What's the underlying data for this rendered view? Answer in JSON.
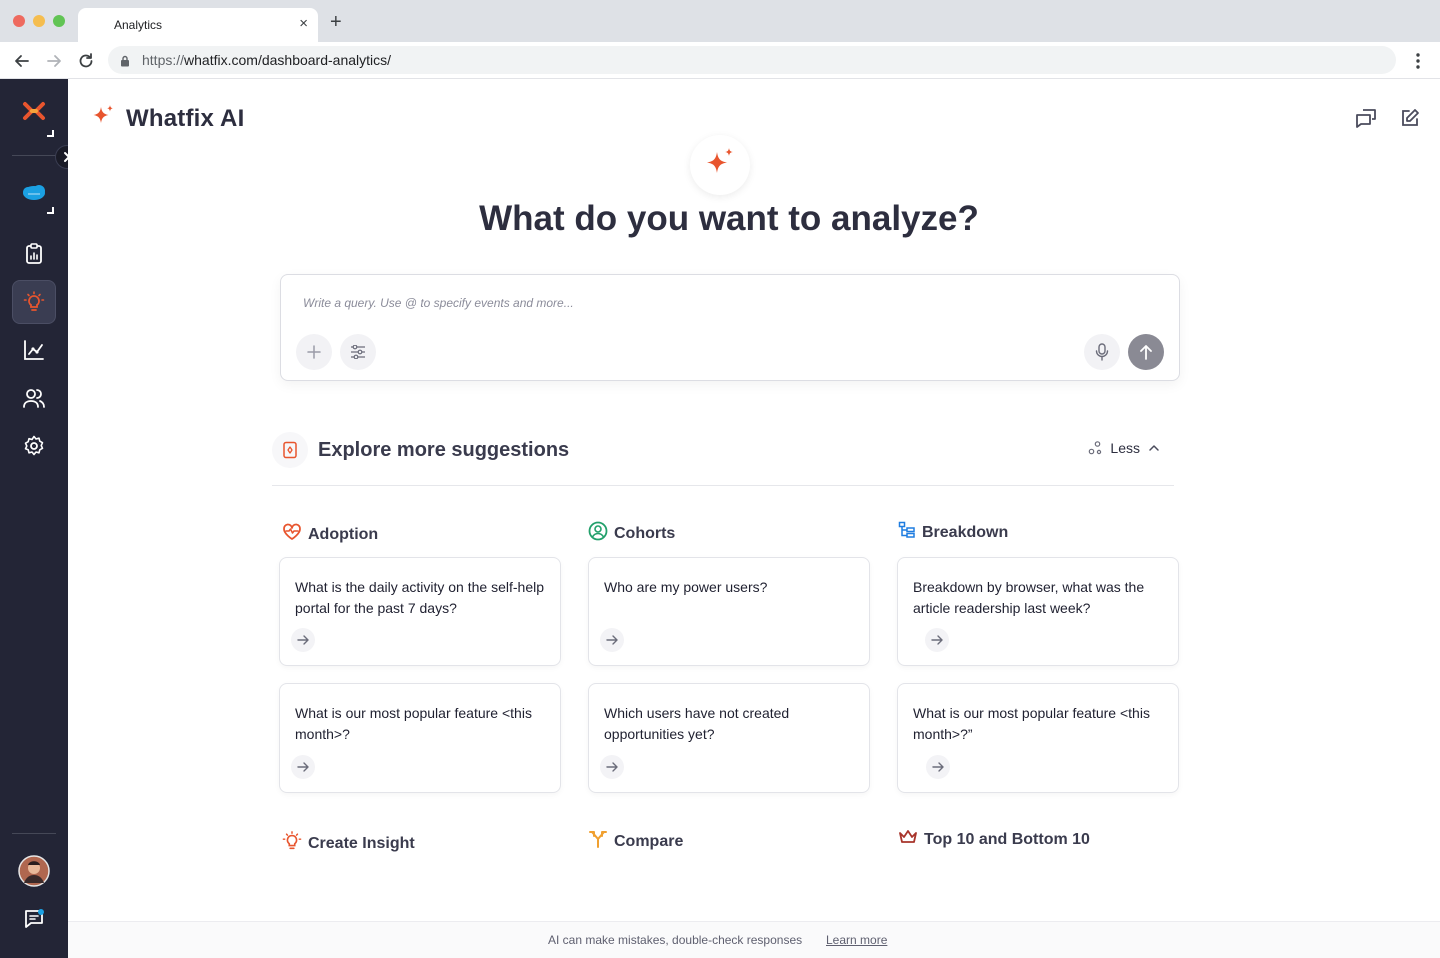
{
  "browser": {
    "tab_title": "Analytics",
    "tab_close": "×",
    "new_tab": "+",
    "url_scheme": "https://",
    "url_rest": "whatfix.com/dashboard-analytics/"
  },
  "rail": {
    "items": [
      {
        "name": "whatfix-logo-icon"
      },
      {
        "name": "salesforce-icon"
      },
      {
        "name": "clipboard-report-icon"
      },
      {
        "name": "lightbulb-icon",
        "active": true
      },
      {
        "name": "chart-line-icon"
      },
      {
        "name": "users-icon"
      },
      {
        "name": "gear-icon"
      },
      {
        "name": "avatar"
      },
      {
        "name": "chat-icon"
      }
    ]
  },
  "header": {
    "title": "Whatfix AI"
  },
  "hero": {
    "title": "What do you want to analyze?"
  },
  "query": {
    "placeholder": "Write a query. Use @ to specify events and more..."
  },
  "explore": {
    "title": "Explore more suggestions",
    "toggle_label": "Less"
  },
  "categories": [
    {
      "title": "Adoption",
      "icon": "heart-pulse-icon",
      "color": "#e8552e",
      "cards": [
        "What is the daily activity on the self-help portal for the past 7 days?",
        "What is our most popular feature <this month>?"
      ]
    },
    {
      "title": "Cohorts",
      "icon": "user-circle-icon",
      "color": "#22a06b",
      "cards": [
        "Who are my power users?",
        "Which users have not created opportunities yet?"
      ]
    },
    {
      "title": "Breakdown",
      "icon": "hierarchy-icon",
      "color": "#1f7de0",
      "cards": [
        "Breakdown by browser, what was the article readership last week?",
        "What is our most popular feature <this month>?”"
      ]
    }
  ],
  "more_categories": [
    {
      "title": "Create Insight",
      "icon": "lightbulb-icon",
      "color": "#e8552e"
    },
    {
      "title": "Compare",
      "icon": "split-arrow-icon",
      "color": "#f0a030"
    },
    {
      "title": "Top 10 and Bottom 10",
      "icon": "crown-icon",
      "color": "#a8342b"
    }
  ],
  "footer": {
    "disclaimer": "AI can make mistakes, double-check responses",
    "link": "Learn more"
  },
  "colors": {
    "accent": "#e8552e",
    "rail_bg": "#232536"
  }
}
